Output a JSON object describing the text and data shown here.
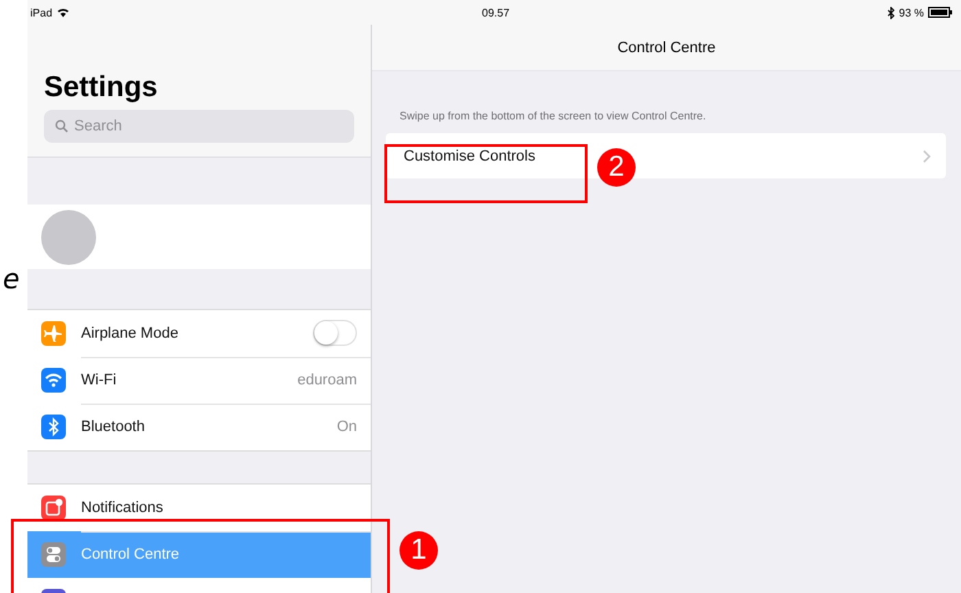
{
  "status_bar": {
    "device": "iPad",
    "time": "09.57",
    "battery": "93 %"
  },
  "margin_text": "e",
  "sidebar": {
    "title": "Settings",
    "search": {
      "placeholder": "Search"
    },
    "groups": [
      {
        "items": [
          {
            "kind": "toggle",
            "label": "Airplane Mode",
            "color": "#ff9500",
            "on": false,
            "selected": false
          },
          {
            "kind": "value",
            "label": "Wi-Fi",
            "value": "eduroam",
            "color": "#147efb",
            "selected": false
          },
          {
            "kind": "value",
            "label": "Bluetooth",
            "value": "On",
            "color": "#147efb",
            "selected": false
          }
        ]
      },
      {
        "items": [
          {
            "kind": "plain",
            "label": "Notifications",
            "color": "#fc3d39",
            "selected": false
          },
          {
            "kind": "plain",
            "label": "Control Centre",
            "color": "#8e8e93",
            "selected": true
          },
          {
            "kind": "plain",
            "color": "#5856d6",
            "selected": false
          }
        ]
      }
    ]
  },
  "detail": {
    "title": "Control Centre",
    "note": "Swipe up from the bottom of the screen to view Control Centre.",
    "rows": [
      {
        "label": "Customise Controls"
      }
    ]
  },
  "annotations": [
    {
      "number": "1"
    },
    {
      "number": "2"
    }
  ]
}
